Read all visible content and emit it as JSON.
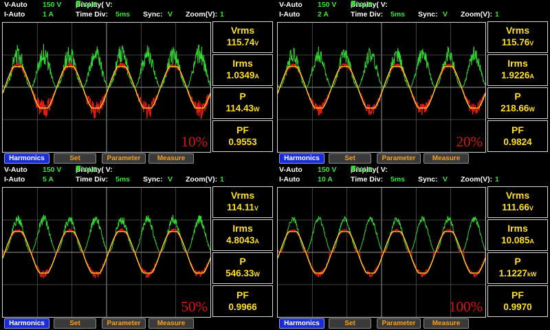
{
  "colors": {
    "voltage": "#ffe020",
    "current": "#e81818",
    "power": "#30d830"
  },
  "icons": {
    "voltage_swatch": "yellow-square",
    "current_swatch": "red-square",
    "power_swatch": "green-square"
  },
  "panels": [
    {
      "v_mode": "V-Auto",
      "v_range": "150 V",
      "i_mode": "I-Auto",
      "i_range": "1 A",
      "display_label": "Display( V:",
      "i_key": " I:",
      "p_key": " P:",
      "display_value": "): V,I,P",
      "time_div_label": "Time  Div:",
      "time_div": "5ms",
      "sync_label": "Sync:",
      "sync": "V",
      "zoom_label": "Zoom(V):",
      "zoom": "1",
      "percent": "10%",
      "vrms_label": "Vrms",
      "vrms": "115.74",
      "vrms_unit": "V",
      "irms_label": "Irms",
      "irms": "1.0349",
      "irms_unit": "A",
      "p_label": "P",
      "p": "114.43",
      "p_unit": "W",
      "pf_label": "PF",
      "pf": "0.9553",
      "buttons": [
        "Harmonics",
        "Set",
        "Parameter",
        "Measure"
      ],
      "waveform": {
        "cycles": 4.0,
        "phase_deg": 0,
        "current_ripple": 0.45,
        "power_ripple": 0.4,
        "current_flat": 0.0
      }
    },
    {
      "v_mode": "V-Auto",
      "v_range": "150 V",
      "i_mode": "I-Auto",
      "i_range": "2 A",
      "display_label": "Display( V:",
      "i_key": " I:",
      "p_key": " P:",
      "display_value": "): V,I,P",
      "time_div_label": "Time  Div:",
      "time_div": "5ms",
      "sync_label": "Sync:",
      "sync": "V",
      "zoom_label": "Zoom(V):",
      "zoom": "1",
      "percent": "20%",
      "vrms_label": "Vrms",
      "vrms": "115.76",
      "vrms_unit": "V",
      "irms_label": "Irms",
      "irms": "1.9226",
      "irms_unit": "A",
      "p_label": "P",
      "p": "218.66",
      "p_unit": "W",
      "pf_label": "PF",
      "pf": "0.9824",
      "buttons": [
        "Harmonics",
        "Set",
        "Parameter",
        "Measure"
      ],
      "waveform": {
        "cycles": 4.0,
        "phase_deg": 0,
        "current_ripple": 0.3,
        "power_ripple": 0.3,
        "current_flat": 0.0
      }
    },
    {
      "v_mode": "V-Auto",
      "v_range": "150 V",
      "i_mode": "I-Auto",
      "i_range": "5 A",
      "display_label": "Display( V:",
      "i_key": " I:",
      "p_key": " P:",
      "display_value": "): V,I,P",
      "time_div_label": "Time  Div:",
      "time_div": "5ms",
      "sync_label": "Sync:",
      "sync": "V",
      "zoom_label": "Zoom(V):",
      "zoom": "1",
      "percent": "50%",
      "vrms_label": "Vrms",
      "vrms": "114.11",
      "vrms_unit": "V",
      "irms_label": "Irms",
      "irms": "4.8043",
      "irms_unit": "A",
      "p_label": "P",
      "p": "546.33",
      "p_unit": "W",
      "pf_label": "PF",
      "pf": "0.9966",
      "buttons": [
        "Harmonics",
        "Set",
        "Parameter",
        "Measure"
      ],
      "waveform": {
        "cycles": 4.0,
        "phase_deg": 0,
        "current_ripple": 0.18,
        "power_ripple": 0.18,
        "current_flat": 0.15
      }
    },
    {
      "v_mode": "V-Auto",
      "v_range": "150 V",
      "i_mode": "I-Auto",
      "i_range": "10 A",
      "display_label": "Display( V:",
      "i_key": " I:",
      "p_key": " P:",
      "display_value": "): V,I,P",
      "time_div_label": "Time  Div:",
      "time_div": "5ms",
      "sync_label": "Sync:",
      "sync": "V",
      "zoom_label": "Zoom(V):",
      "zoom": "1",
      "percent": "100%",
      "vrms_label": "Vrms",
      "vrms": "111.66",
      "vrms_unit": "V",
      "irms_label": "Irms",
      "irms": "10.085",
      "irms_unit": "A",
      "p_label": "P",
      "p": "1.1227",
      "p_unit": "kW",
      "pf_label": "PF",
      "pf": "0.9970",
      "buttons": [
        "Harmonics",
        "Set",
        "Parameter",
        "Measure"
      ],
      "waveform": {
        "cycles": 4.0,
        "phase_deg": 0,
        "current_ripple": 0.12,
        "power_ripple": 0.12,
        "current_flat": 0.25
      }
    }
  ]
}
